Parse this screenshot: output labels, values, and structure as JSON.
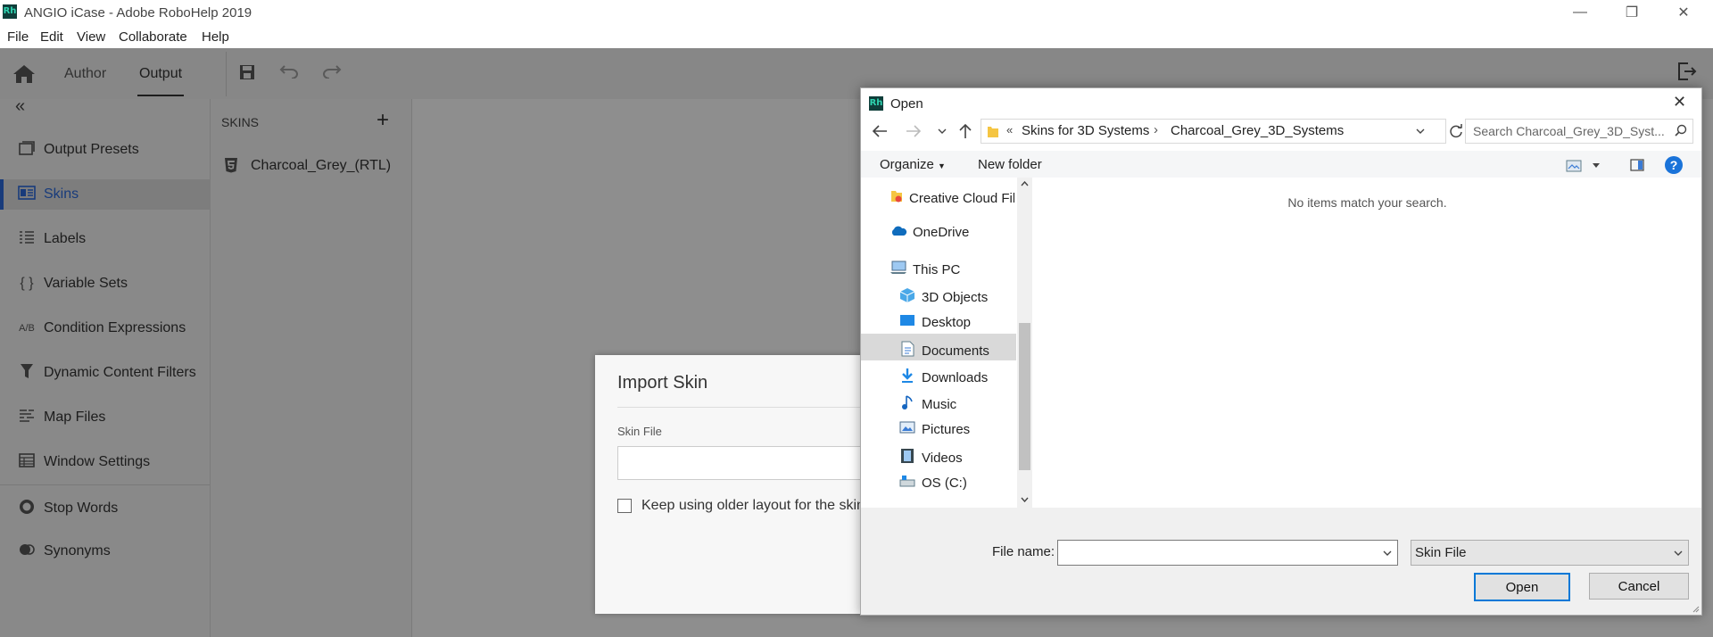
{
  "app": {
    "title": "ANGIO iCase - Adobe RoboHelp 2019",
    "logo_text": "Rh"
  },
  "window_controls": {
    "minimize": "—",
    "restore": "❐",
    "close": "✕"
  },
  "menubar": [
    "File",
    "Edit",
    "View",
    "Collaborate",
    "Help"
  ],
  "toolbar": {
    "tabs": [
      "Author",
      "Output"
    ],
    "active_tab": "Output"
  },
  "left_nav": {
    "collapse_icon": "«",
    "items": [
      {
        "label": "Output Presets",
        "icon": "output-presets-icon"
      },
      {
        "label": "Skins",
        "icon": "skins-icon"
      },
      {
        "label": "Labels",
        "icon": "labels-icon"
      },
      {
        "label": "Variable Sets",
        "icon": "braces-icon",
        "glyph": "{ }"
      },
      {
        "label": "Condition Expressions",
        "icon": "condition-icon",
        "glyph": "A/B"
      },
      {
        "label": "Dynamic Content Filters",
        "icon": "filter-icon"
      },
      {
        "label": "Map Files",
        "icon": "map-files-icon"
      },
      {
        "label": "Window Settings",
        "icon": "window-settings-icon"
      },
      {
        "label": "Stop Words",
        "icon": "stop-words-icon"
      },
      {
        "label": "Synonyms",
        "icon": "synonyms-icon"
      }
    ],
    "active": "Skins"
  },
  "skins_panel": {
    "header": "SKINS",
    "add": "+",
    "items": [
      "Charcoal_Grey_(RTL)"
    ]
  },
  "import_dialog": {
    "title": "Import Skin",
    "skin_file_label": "Skin File",
    "skin_file_value": "",
    "checkbox_label": "Keep using older layout for the skin"
  },
  "open_dialog": {
    "title": "Open",
    "logo_text": "Rh",
    "close": "✕",
    "breadcrumb": {
      "prefix": "«",
      "segments": [
        "Skins for 3D Systems",
        "Charcoal_Grey_3D_Systems"
      ],
      "separator": "›"
    },
    "search_placeholder": "Search Charcoal_Grey_3D_Syst...",
    "organize_label": "Organize",
    "new_folder_label": "New folder",
    "help": "?",
    "tree": [
      {
        "label": "Creative Cloud Files",
        "icon": "creative-cloud-icon"
      },
      {
        "label": "OneDrive",
        "icon": "onedrive-icon"
      },
      {
        "label": "This PC",
        "icon": "this-pc-icon"
      },
      {
        "label": "3D Objects",
        "icon": "3d-objects-icon"
      },
      {
        "label": "Desktop",
        "icon": "desktop-icon"
      },
      {
        "label": "Documents",
        "icon": "documents-icon"
      },
      {
        "label": "Downloads",
        "icon": "downloads-icon"
      },
      {
        "label": "Music",
        "icon": "music-icon"
      },
      {
        "label": "Pictures",
        "icon": "pictures-icon"
      },
      {
        "label": "Videos",
        "icon": "videos-icon"
      },
      {
        "label": "OS (C:)",
        "icon": "drive-icon"
      }
    ],
    "selected_tree": "Documents",
    "empty_message": "No items match your search.",
    "file_name_label": "File name:",
    "file_name_value": "",
    "file_type_value": "Skin File",
    "open_button": "Open",
    "cancel_button": "Cancel"
  },
  "colors": {
    "accent": "#2a66d5",
    "dialog_button_border": "#0078d7",
    "selection": "#cce8ff"
  }
}
